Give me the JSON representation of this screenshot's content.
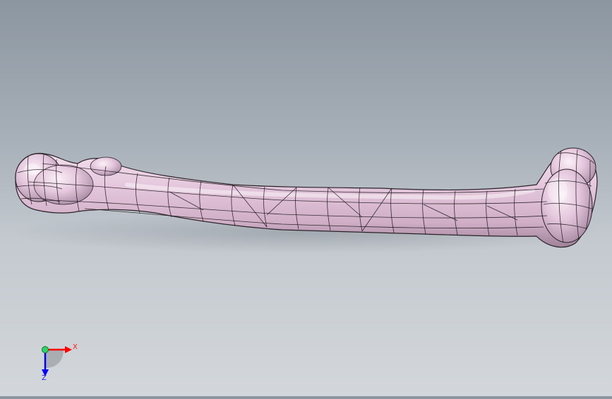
{
  "scene": {
    "model": "femur-surface-model",
    "colors": {
      "background_top": "#8c96a0",
      "background_bottom": "#d3d7db",
      "model_fill": "#e2c3dc",
      "model_shadow": "#a88ba3",
      "model_highlight": "#f8eef6",
      "wireframe": "#111111"
    }
  },
  "triad": {
    "x_label": "X",
    "z_label": "Z",
    "colors": {
      "x": "#ff0000",
      "y": "#00b000",
      "z": "#0000ff",
      "origin": "#2fd36a"
    }
  }
}
